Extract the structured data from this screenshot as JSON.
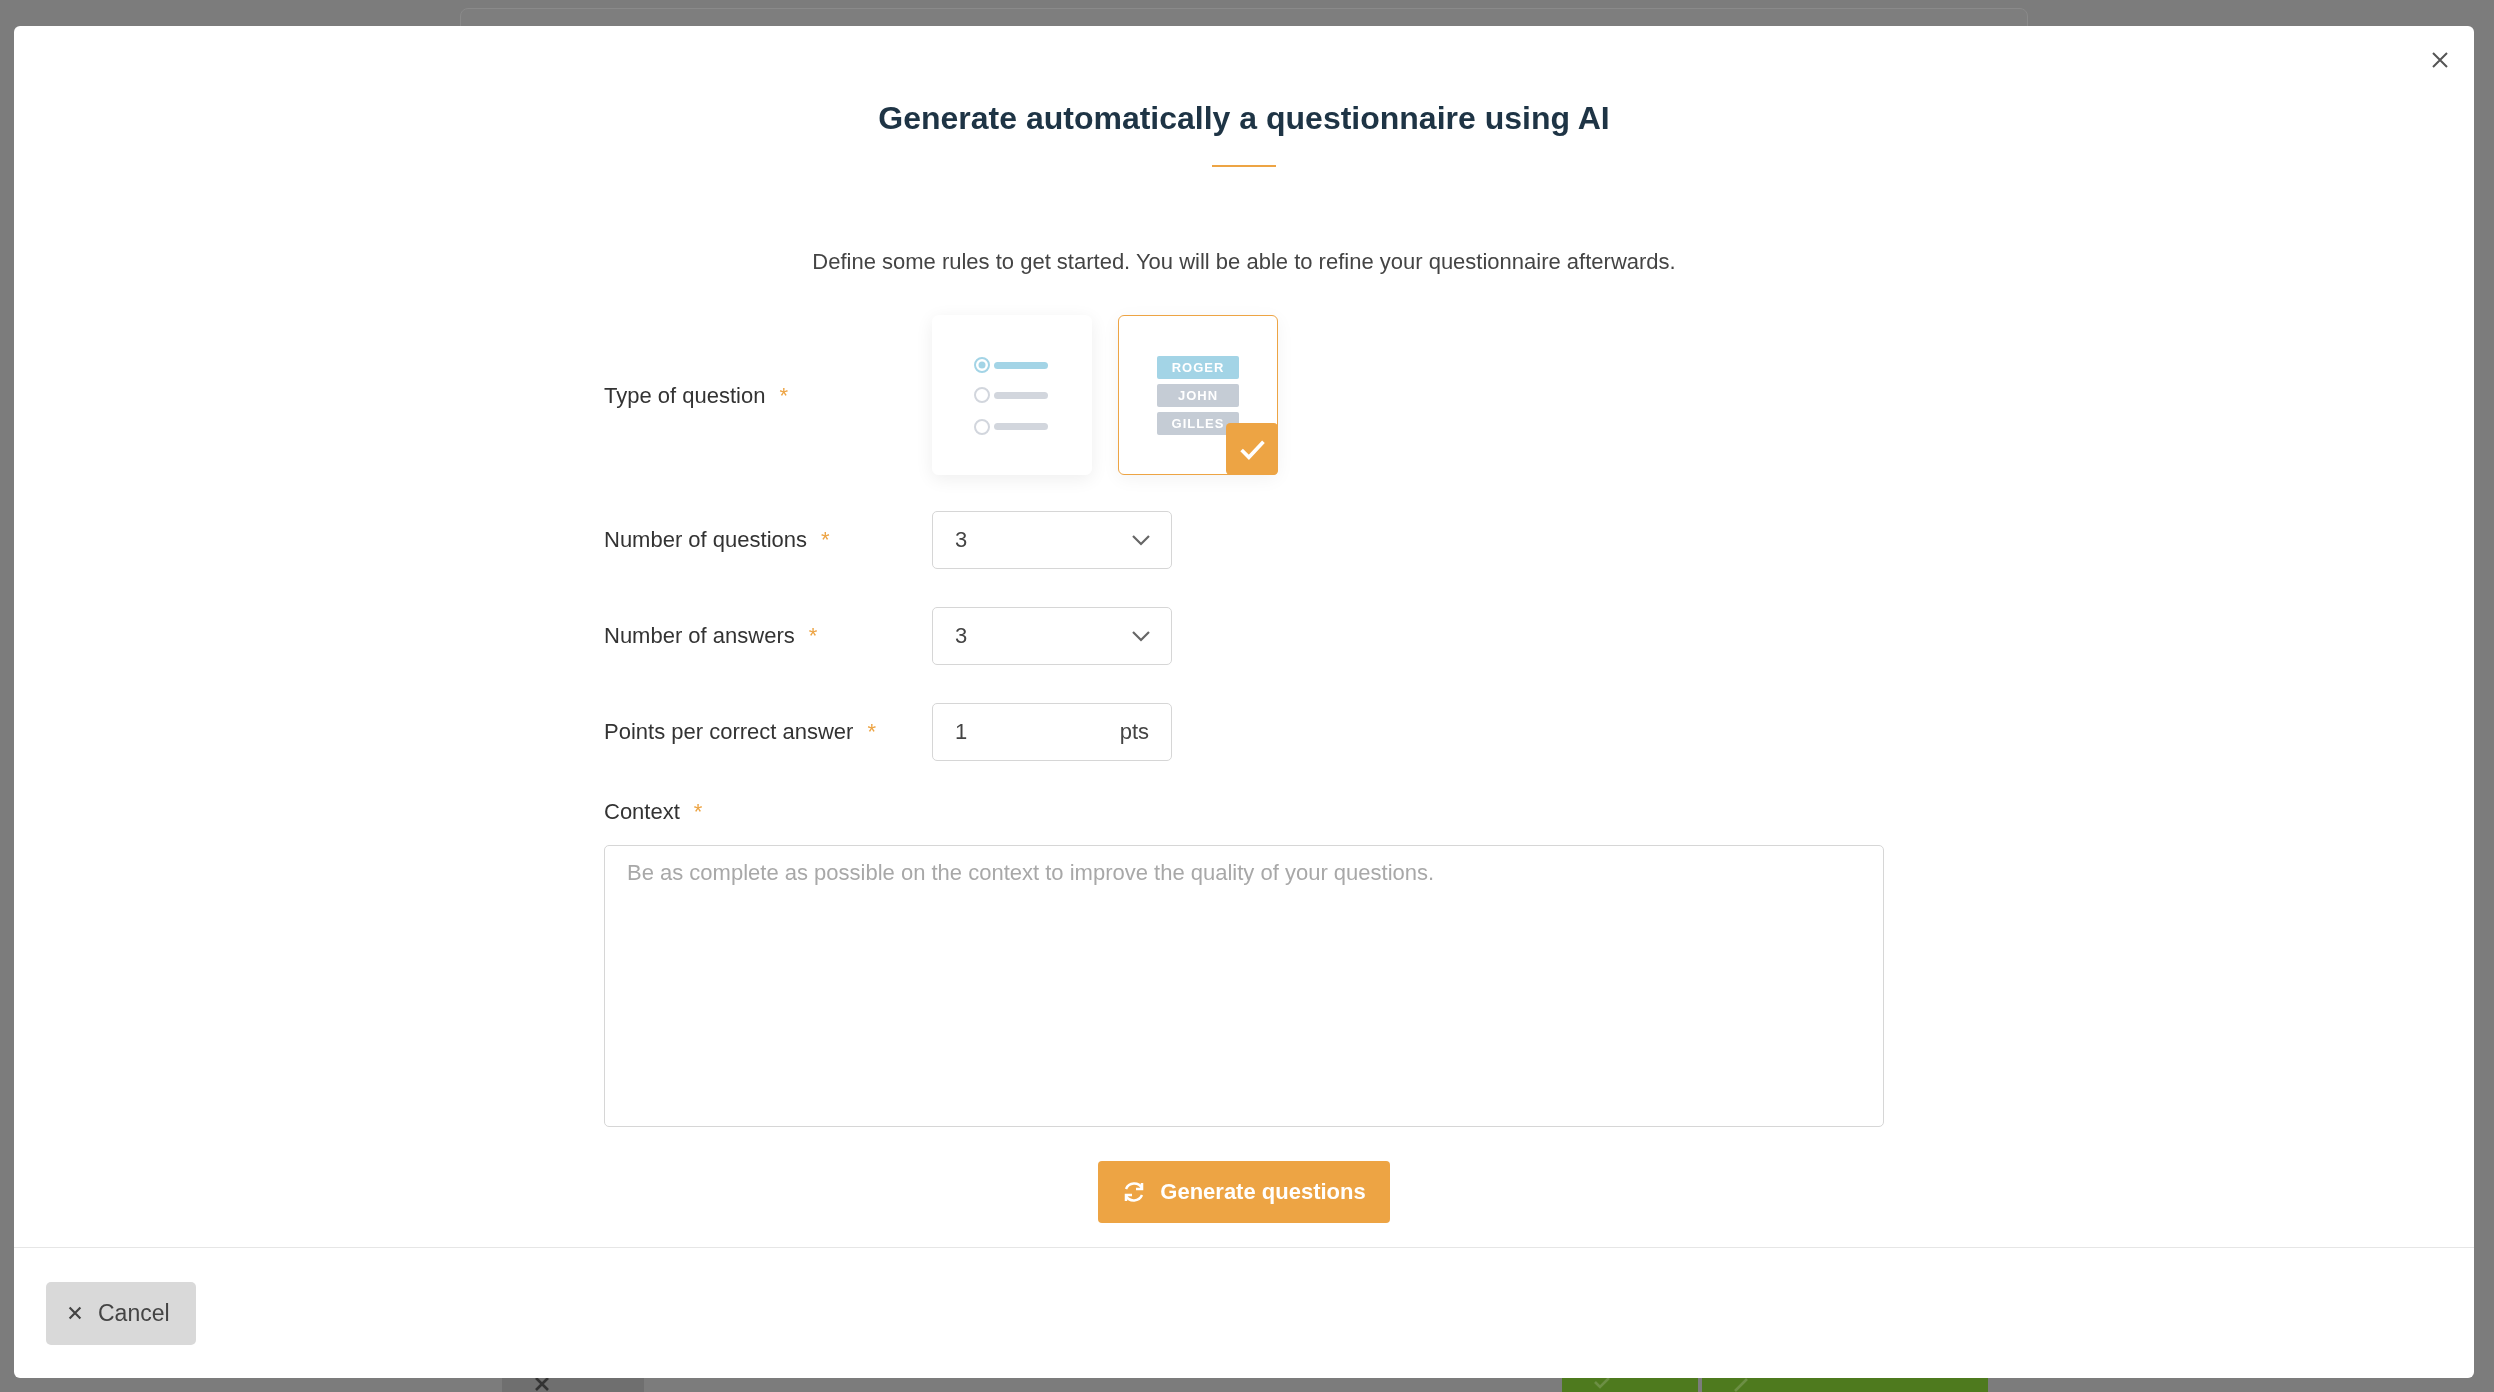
{
  "background_page": {
    "footer_buttons": [
      {
        "kind": "close"
      },
      {
        "kind": "save"
      },
      {
        "kind": "continue"
      }
    ]
  },
  "dialog": {
    "title": "Generate automatically a questionnaire using AI",
    "intro": "Define some rules to get started. You will be able to refine your questionnaire afterwards.",
    "question_type": {
      "label": "Type of question",
      "required_mark": "*",
      "options": [
        {
          "kind": "radio_list",
          "selected": false
        },
        {
          "kind": "name_tags",
          "selected": true,
          "tags": [
            "ROGER",
            "JOHN",
            "GILLES"
          ]
        }
      ]
    },
    "number_of_questions": {
      "label": "Number of questions",
      "required_mark": "*",
      "value": "3"
    },
    "number_of_answers": {
      "label": "Number of answers",
      "required_mark": "*",
      "value": "3"
    },
    "points_per_correct_answer": {
      "label": "Points per correct answer",
      "required_mark": "*",
      "value": "1",
      "unit": "pts"
    },
    "context": {
      "label": "Context",
      "required_mark": "*",
      "placeholder": "Be as complete as possible on the context to improve the quality of your questions."
    },
    "generate_button": "Generate questions",
    "cancel_button": "Cancel"
  }
}
